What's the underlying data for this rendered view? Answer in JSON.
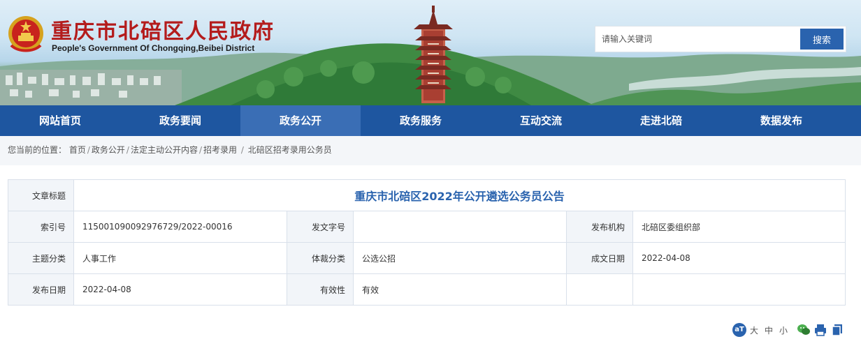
{
  "header": {
    "title": "重庆市北碚区人民政府",
    "subtitle": "People's Government Of Chongqing,Beibei District",
    "search": {
      "placeholder": "请输入关键词",
      "button_label": "搜索"
    }
  },
  "nav": {
    "items": [
      {
        "label": "网站首页"
      },
      {
        "label": "政务要闻"
      },
      {
        "label": "政务公开",
        "active": true
      },
      {
        "label": "政务服务"
      },
      {
        "label": "互动交流"
      },
      {
        "label": "走进北碚"
      },
      {
        "label": "数据发布"
      }
    ]
  },
  "breadcrumb": {
    "prefix": "您当前的位置：",
    "items": [
      "首页",
      "政务公开",
      "法定主动公开内容",
      "招考录用",
      "北碚区招考录用公务员"
    ]
  },
  "info": {
    "title_label": "文章标题",
    "title": "重庆市北碚区2022年公开遴选公务员公告",
    "index_label": "索引号",
    "index_value": "115001090092976729/2022-00016",
    "doc_no_label": "发文字号",
    "doc_no_value": "",
    "agency_label": "发布机构",
    "agency_value": "北碚区委组织部",
    "topic_label": "主题分类",
    "topic_value": "人事工作",
    "genre_label": "体裁分类",
    "genre_value": "公选公招",
    "written_date_label": "成文日期",
    "written_date_value": "2022-04-08",
    "publish_date_label": "发布日期",
    "publish_date_value": "2022-04-08",
    "validity_label": "有效性",
    "validity_value": "有效"
  },
  "tools": {
    "font_size_labels": [
      "大",
      "中",
      "小"
    ],
    "font_icon_text": "aT",
    "icons": [
      "font-size-icon",
      "wechat-icon",
      "print-icon",
      "copy-icon"
    ]
  },
  "colors": {
    "nav_bg": "#1e56a0",
    "nav_active": "#3a6eb5",
    "accent": "#2a63ae",
    "title_red": "#b41c1c"
  }
}
